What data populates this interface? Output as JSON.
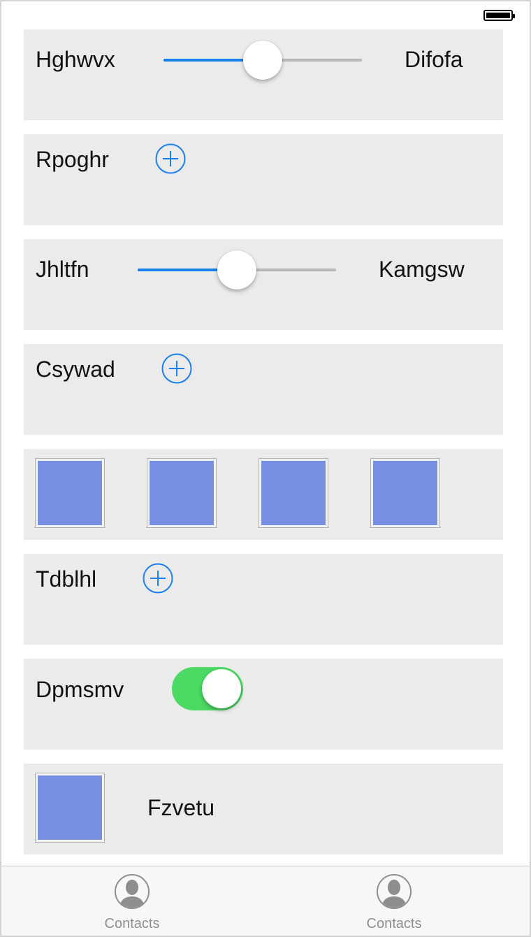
{
  "status_bar": {
    "battery_icon": "battery-full-icon"
  },
  "rows": [
    {
      "type": "slider",
      "label_left": "Hghwvx",
      "label_right": "Difofa",
      "value": 0.5
    },
    {
      "type": "add",
      "label": "Rpoghr",
      "icon": "plus-circle-icon"
    },
    {
      "type": "slider",
      "label_left": "Jhltfn",
      "label_right": "Kamgsw",
      "value": 0.5
    },
    {
      "type": "add",
      "label": "Csywad",
      "icon": "plus-circle-icon"
    },
    {
      "type": "images",
      "count": 4
    },
    {
      "type": "add",
      "label": "Tdblhl",
      "icon": "plus-circle-icon"
    },
    {
      "type": "switch",
      "label": "Dpmsmv",
      "on": true
    },
    {
      "type": "image-label",
      "label": "Fzvetu"
    }
  ],
  "tab_bar": {
    "tabs": [
      {
        "label": "Contacts",
        "icon": "contacts-icon"
      },
      {
        "label": "Contacts",
        "icon": "contacts-icon"
      }
    ]
  },
  "colors": {
    "accent": "#1a7fef",
    "switch_on": "#4cd964",
    "image_fill": "#7890e4",
    "row_background": "#ebebeb"
  }
}
